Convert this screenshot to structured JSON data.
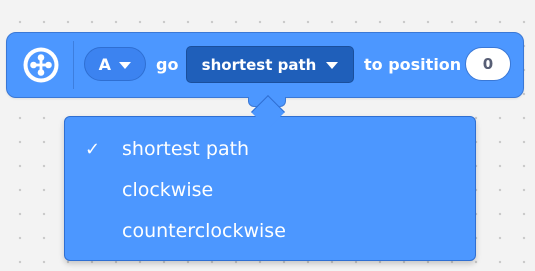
{
  "block": {
    "port": "A",
    "go_label": "go",
    "direction": "shortest path",
    "to_position_label": "to position",
    "position_value": "0",
    "icon": "motor-icon",
    "color": "#4c97ff"
  },
  "menu": {
    "items": [
      {
        "label": "shortest path",
        "selected": true
      },
      {
        "label": "clockwise",
        "selected": false
      },
      {
        "label": "counterclockwise",
        "selected": false
      }
    ],
    "checkmark": "✓"
  },
  "colors": {
    "block": "#4c97ff",
    "block_border": "#3a78d6",
    "selected_field": "#1f5fba",
    "canvas": "#f3f3f3",
    "input_text": "#575e75"
  }
}
